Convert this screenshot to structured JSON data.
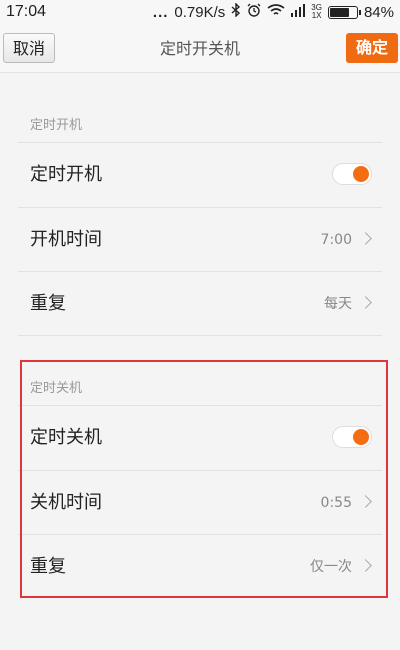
{
  "status_bar": {
    "time": "17:04",
    "dots": "...",
    "speed": "0.79K/s",
    "network_top": "3G",
    "network_bottom": "1X",
    "battery": "84%",
    "battery_level": 0.84
  },
  "header": {
    "cancel_label": "取消",
    "title": "定时开关机",
    "confirm_label": "确定",
    "accent_color": "#f06a12"
  },
  "power_on": {
    "section_label": "定时开机",
    "toggle_label": "定时开机",
    "toggle_on": true,
    "time_label": "开机时间",
    "time_value": "7:00",
    "repeat_label": "重复",
    "repeat_value": "每天"
  },
  "power_off": {
    "section_label": "定时关机",
    "toggle_label": "定时关机",
    "toggle_on": true,
    "time_label": "关机时间",
    "time_value": "0:55",
    "repeat_label": "重复",
    "repeat_value": "仅一次"
  },
  "highlight_color": "#e0353d"
}
